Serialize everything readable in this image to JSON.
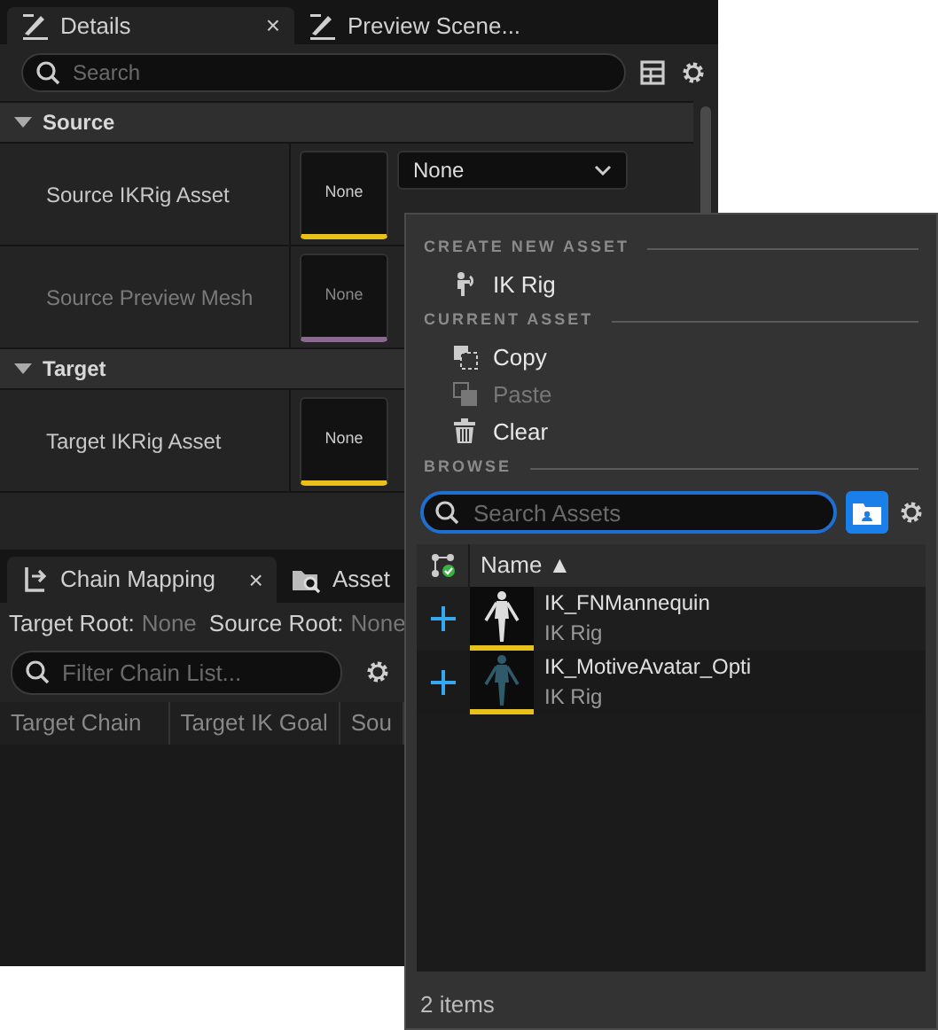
{
  "details_panel": {
    "tabs": [
      {
        "label": "Details",
        "selected": true,
        "close": "×"
      },
      {
        "label": "Preview Scene...",
        "selected": false
      }
    ],
    "search": {
      "placeholder": "Search"
    },
    "sections": [
      {
        "title": "Source",
        "expanded": true,
        "rows": [
          {
            "label": "Source IKRig Asset",
            "disabled": false,
            "thumbnail": "None",
            "color": "#e8c21a",
            "value": "None"
          },
          {
            "label": "Source Preview Mesh",
            "disabled": true,
            "thumbnail": "None",
            "color": "#8a6a8e"
          }
        ]
      },
      {
        "title": "Target",
        "expanded": true,
        "rows": [
          {
            "label": "Target IKRig Asset",
            "disabled": false,
            "thumbnail": "None",
            "color": "#e8c21a"
          }
        ]
      }
    ]
  },
  "chain_panel": {
    "tabs": [
      {
        "label": "Chain Mapping",
        "selected": true,
        "close": "×",
        "kind": "chain"
      },
      {
        "label": "Asset",
        "selected": false,
        "kind": "asset"
      }
    ],
    "roots": [
      {
        "label": "Target Root:",
        "value": "None"
      },
      {
        "label": "Source Root:",
        "value": "None"
      }
    ],
    "filter": {
      "placeholder": "Filter Chain List..."
    },
    "columns": [
      "Target Chain",
      "Target IK Goal",
      "Sou"
    ]
  },
  "asset_picker": {
    "sections": [
      {
        "title": "CREATE NEW ASSET",
        "items": [
          {
            "label": "IK Rig",
            "kind": "rig",
            "disabled": false
          }
        ]
      },
      {
        "title": "CURRENT ASSET",
        "items": [
          {
            "label": "Copy",
            "kind": "copy",
            "disabled": false
          },
          {
            "label": "Paste",
            "kind": "paste",
            "disabled": true
          },
          {
            "label": "Clear",
            "kind": "clear",
            "disabled": false
          }
        ]
      },
      {
        "title": "BROWSE"
      }
    ],
    "search": {
      "placeholder": "Search Assets"
    },
    "columns": [
      {
        "label": "Name",
        "sort": "▲"
      }
    ],
    "assets": [
      {
        "name": "IK_FNMannequin",
        "type": "IK Rig",
        "color": "#e8c21a",
        "kind": "light"
      },
      {
        "name": "IK_MotiveAvatar_Opti",
        "type": "IK Rig",
        "color": "#e8c21a",
        "kind": "dark"
      }
    ],
    "footer": "2 items"
  }
}
